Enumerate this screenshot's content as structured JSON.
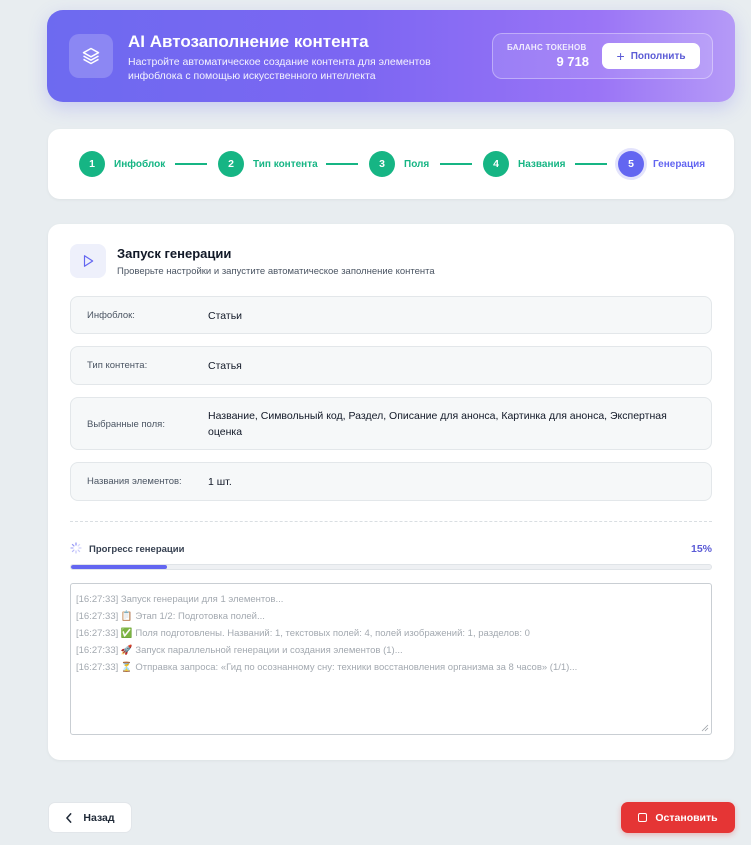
{
  "header": {
    "title": "AI Автозаполнение контента",
    "subtitle": "Настройте автоматическое создание контента для элементов инфоблока с помощью искусственного интеллекта",
    "logo_icon": "layers-icon",
    "balance_label": "БАЛАНС ТОКЕНОВ",
    "balance_value": "9 718",
    "topup_label": "Пополнить"
  },
  "steps": [
    {
      "num": "1",
      "label": "Инфоблок",
      "state": "done"
    },
    {
      "num": "2",
      "label": "Тип контента",
      "state": "done"
    },
    {
      "num": "3",
      "label": "Поля",
      "state": "done"
    },
    {
      "num": "4",
      "label": "Названия",
      "state": "done"
    },
    {
      "num": "5",
      "label": "Генерация",
      "state": "active"
    }
  ],
  "section": {
    "icon": "play-icon",
    "title": "Запуск генерации",
    "subtitle": "Проверьте настройки и запустите автоматическое заполнение контента"
  },
  "summary": [
    {
      "key": "Инфоблок:",
      "value": "Статьи"
    },
    {
      "key": "Тип контента:",
      "value": "Статья"
    },
    {
      "key": "Выбранные поля:",
      "value": "Название, Символьный код, Раздел, Описание для анонса, Картинка для анонса, Экспертная оценка"
    },
    {
      "key": "Названия элементов:",
      "value": "1 шт."
    }
  ],
  "progress": {
    "label": "Прогресс генерации",
    "percent_text": "15%",
    "fraction": 0.15
  },
  "log": [
    "[16:27:33] Запуск генерации для 1 элементов...",
    "[16:27:33] 📋 Этап 1/2: Подготовка полей...",
    "[16:27:33] ✅ Поля подготовлены. Названий: 1, текстовых полей: 4, полей изображений: 1, разделов: 0",
    "[16:27:33] 🚀 Запуск параллельной генерации и создания элементов (1)...",
    "[16:27:33] ⏳ Отправка запроса: «Гид по осознанному сну: техники восстановления организма за 8 часов» (1/1)..."
  ],
  "footer": {
    "back_label": "Назад",
    "stop_label": "Остановить"
  },
  "colors": {
    "accent": "#6366f1",
    "success": "#16b584",
    "danger": "#e53535"
  }
}
